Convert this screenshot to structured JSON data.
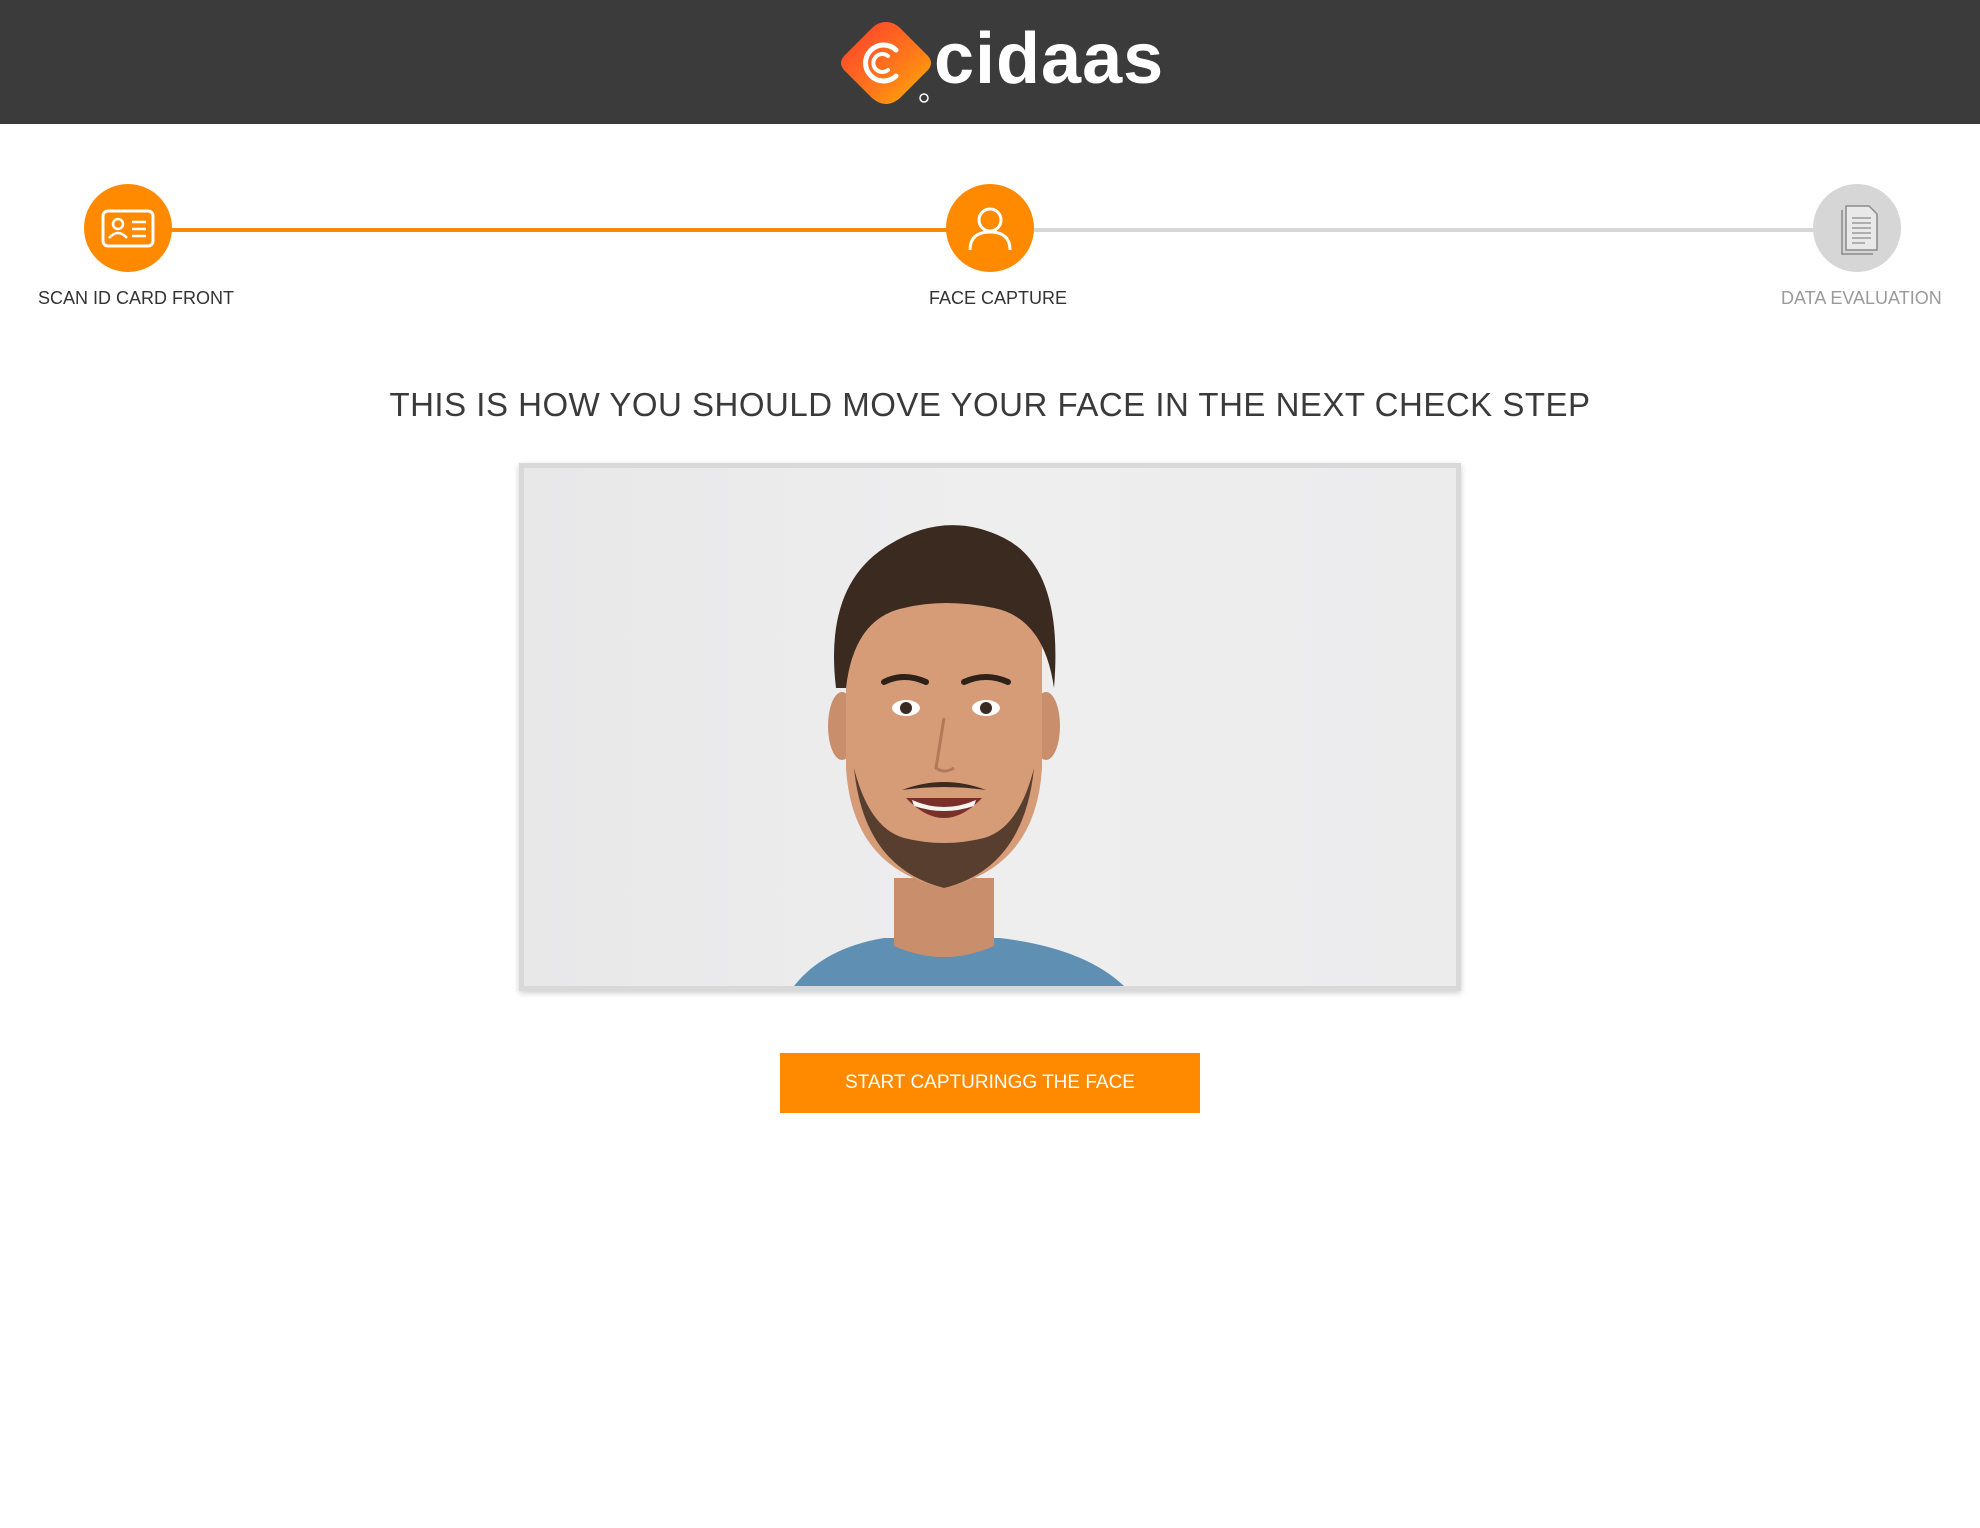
{
  "header": {
    "brand_name": "cidaas",
    "brand_colors": {
      "orange": "#ff8a00",
      "red": "#e8452c",
      "bar": "#3b3b3b"
    },
    "logo_icon": "cidaas-logo-icon"
  },
  "stepper": {
    "steps": [
      {
        "label": "SCAN ID CARD FRONT",
        "icon": "id-card-icon",
        "state": "completed"
      },
      {
        "label": "FACE CAPTURE",
        "icon": "user-icon",
        "state": "active"
      },
      {
        "label": "DATA EVALUATION",
        "icon": "document-icon",
        "state": "pending"
      }
    ],
    "active_color": "#ff8a00",
    "inactive_color": "#d6d6d6"
  },
  "main": {
    "headline": "THIS IS HOW YOU SHOULD MOVE YOUR FACE IN THE NEXT CHECK STEP",
    "image": "face-demo-photo",
    "start_button_label": "START CAPTURINGG THE FACE"
  }
}
